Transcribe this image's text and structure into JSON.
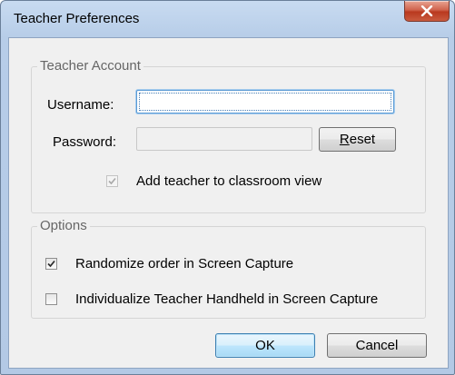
{
  "window": {
    "title": "Teacher Preferences"
  },
  "teacher_account": {
    "legend": "Teacher Account",
    "username_label": "Username:",
    "username_value": "",
    "password_label": "Password:",
    "password_value": "",
    "reset_label": "Reset",
    "add_teacher_label": "Add teacher to classroom view",
    "add_teacher_checked": true,
    "add_teacher_enabled": false
  },
  "options": {
    "legend": "Options",
    "randomize_label": "Randomize order in Screen Capture",
    "randomize_checked": true,
    "individualize_label": "Individualize Teacher Handheld in Screen Capture",
    "individualize_checked": false
  },
  "buttons": {
    "ok_label": "OK",
    "cancel_label": "Cancel"
  }
}
